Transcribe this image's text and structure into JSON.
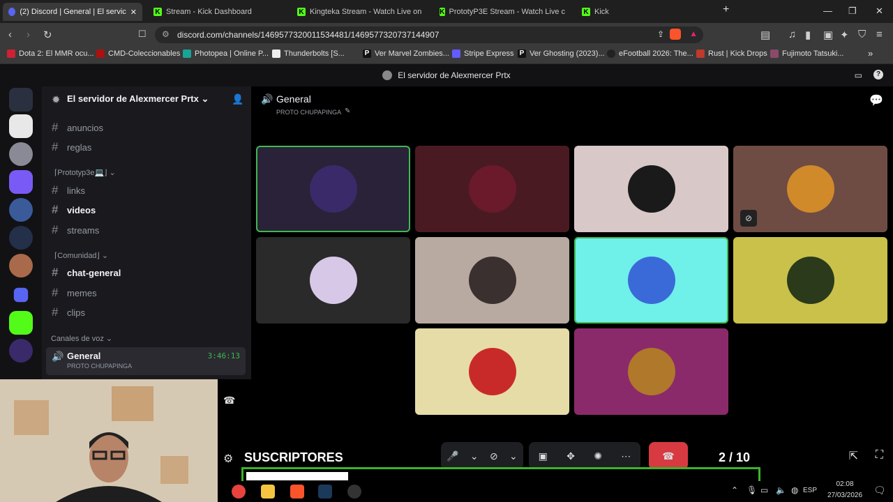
{
  "browser": {
    "tabs": [
      {
        "label": "(2) Discord | General | El servic",
        "active": true
      },
      {
        "label": "Stream - Kick Dashboard"
      },
      {
        "label": "Kingteka Stream - Watch Live on"
      },
      {
        "label": "PrototyP3E Stream - Watch Live c"
      },
      {
        "label": "Kick"
      }
    ],
    "new_tab": "+",
    "url": "discord.com/channels/1469577320011534481/1469577320737144907",
    "bookmarks": [
      "Dota 2: El MMR ocu...",
      "CMD-Coleccionables",
      "Photopea | Online P...",
      "Thunderbolts [S...",
      "Ver Marvel Zombies...",
      "Stripe Express",
      "Ver Ghosting (2023)...",
      "eFootball 2026: The...",
      "Rust | Kick Drops",
      "Fujimoto Tatsuki..."
    ]
  },
  "discord": {
    "window_title": "El servidor de Alexmercer Prtx",
    "server_name": "El servidor de Alexmercer Prtx",
    "channels": {
      "top": [
        "anuncios",
        "reglas"
      ],
      "cat1": "⌈Prototyp3e💻⌋",
      "cat1_items": [
        "links",
        "videos",
        "streams"
      ],
      "cat2": "⌈Comunidad⌋",
      "cat2_items": [
        "chat-general",
        "memes",
        "clips"
      ],
      "voice_cat": "Canales de voz",
      "voice_channel": "General",
      "voice_time": "3:46:13",
      "voice_sub": "PROTO CHUPAPINGA"
    },
    "voice_header": {
      "title": "General",
      "subtitle": "PROTO CHUPAPINGA"
    },
    "tiles": [
      {
        "bg": "#2a2238",
        "speaking": true
      },
      {
        "bg": "#4a1a22"
      },
      {
        "bg": "#d9c8c8"
      },
      {
        "bg": "#6e4c44"
      },
      {
        "bg": "#2a2a2a"
      },
      {
        "bg": "#b8aaa0"
      },
      {
        "bg": "#6ff0e8",
        "speaking": true
      },
      {
        "bg": "#c9c14a"
      },
      {
        "bg": "#e6dca8"
      },
      {
        "bg": "#8a2a6a"
      }
    ]
  },
  "overlay": {
    "sus_label": "SUSCRIPTORES",
    "sus_count": "2 / 10",
    "sus_progress": 0.2
  },
  "taskbar": {
    "lang": "ESP",
    "time": "02:08",
    "date": "27/03/2026"
  }
}
